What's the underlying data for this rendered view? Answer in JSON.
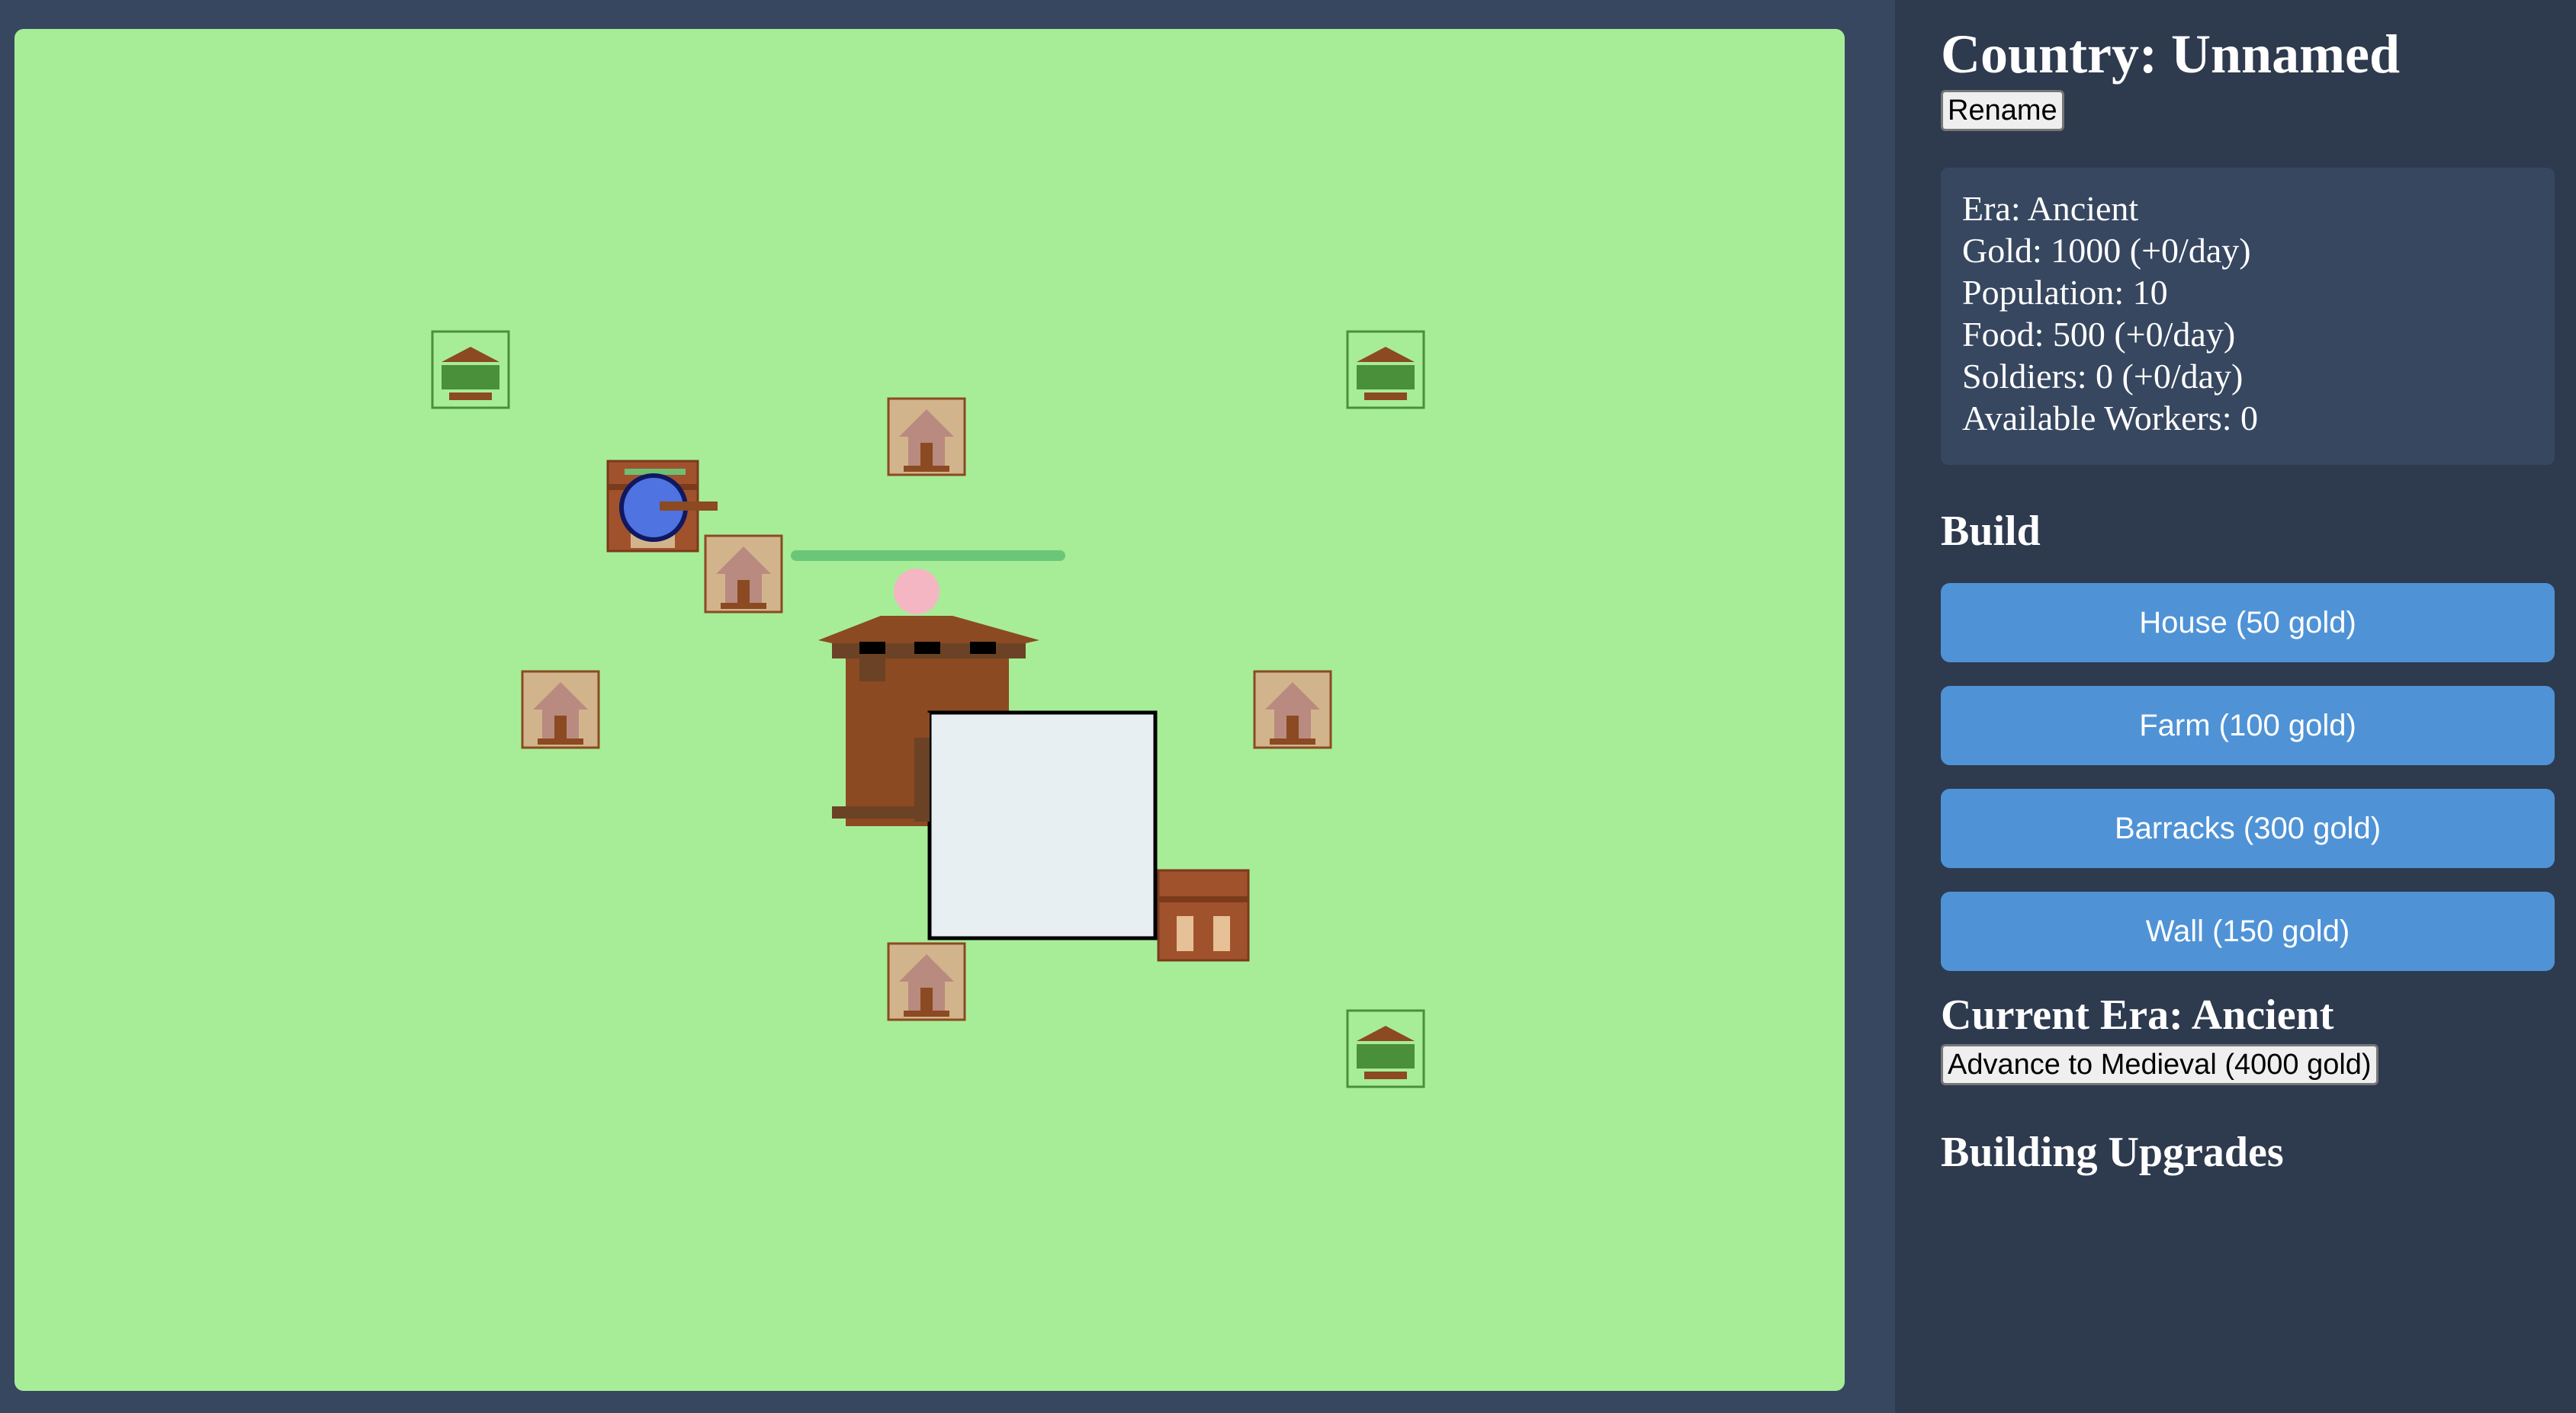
{
  "country": {
    "title": "Country: Unnamed",
    "rename_label": "Rename"
  },
  "stats": {
    "era": "Era: Ancient",
    "gold": "Gold: 1000 (+0/day)",
    "population": "Population: 10",
    "food": "Food: 500 (+0/day)",
    "soldiers": "Soldiers: 0 (+0/day)",
    "workers": "Available Workers: 0"
  },
  "build": {
    "heading": "Build",
    "buttons": [
      {
        "label": "House (50 gold)"
      },
      {
        "label": "Farm (100 gold)"
      },
      {
        "label": "Barracks (300 gold)"
      },
      {
        "label": "Wall (150 gold)"
      }
    ]
  },
  "era": {
    "heading": "Current Era: Ancient",
    "advance_label": "Advance to Medieval (4000 gold)"
  },
  "upgrades": {
    "heading": "Building Upgrades"
  },
  "map": {
    "colors": {
      "grass": "#a7ed97",
      "house": "#d2b48c",
      "farm": "#4a8f3a",
      "wood": "#8b4a22",
      "unit": "#4f73e0"
    },
    "icons": [
      "farm-icon",
      "house-icon",
      "barracks-icon",
      "castle-icon",
      "market-icon",
      "soldier-unit-icon"
    ]
  }
}
